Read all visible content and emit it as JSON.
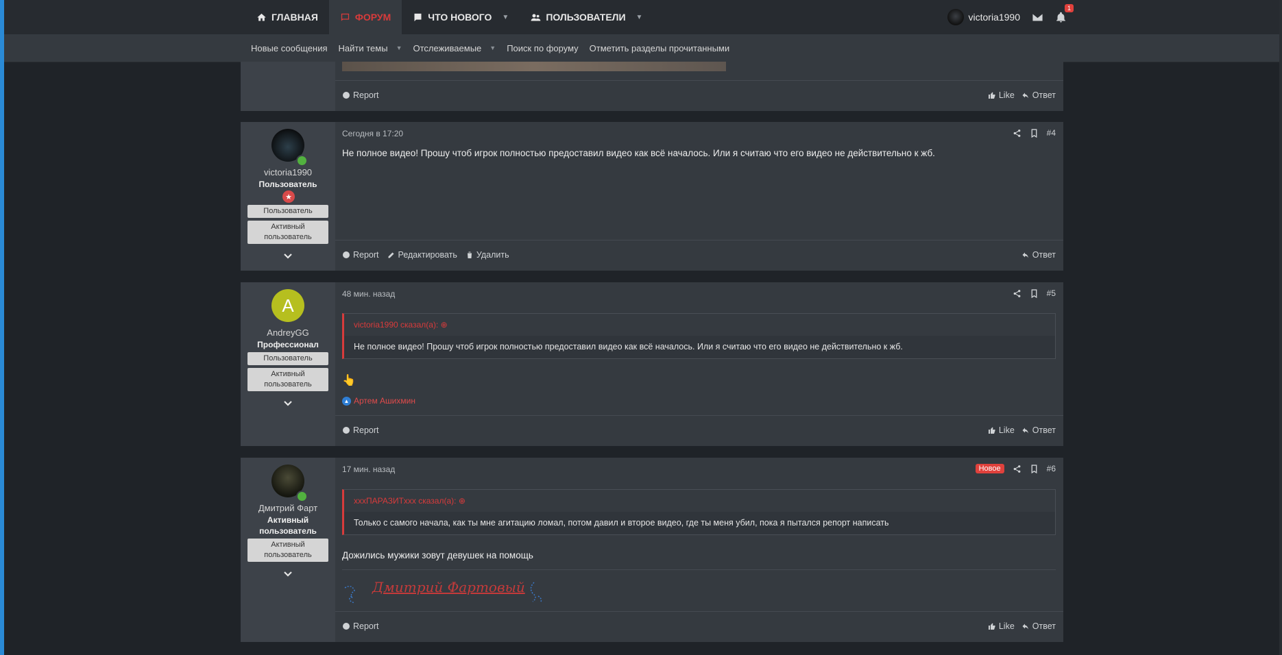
{
  "topnav": {
    "tabs": [
      {
        "label": "ГЛАВНАЯ",
        "icon": "home-icon"
      },
      {
        "label": "ФОРУМ",
        "icon": "forum-icon"
      },
      {
        "label": "ЧТО НОВОГО",
        "icon": "news-icon"
      },
      {
        "label": "ПОЛЬЗОВАТЕЛИ",
        "icon": "users-icon"
      }
    ],
    "username": "victoria1990",
    "alerts_count": "1"
  },
  "subnav": {
    "items": [
      {
        "label": "Новые сообщения"
      },
      {
        "label": "Найти темы"
      },
      {
        "label": "Отслеживаемые"
      },
      {
        "label": "Поиск по форуму"
      },
      {
        "label": "Отметить разделы прочитанными"
      }
    ]
  },
  "actions": {
    "report": "Report",
    "like": "Like",
    "reply": "Ответ",
    "edit": "Редактировать",
    "delete": "Удалить"
  },
  "posts": [
    {
      "user": "victoria1990",
      "title": "Пользователь",
      "badges": [
        "Пользователь",
        "Активный пользователь"
      ],
      "date": "Сегодня в 17:20",
      "num": "#4",
      "text": "Не полное видео! Прошу чтоб игрок полностью предоставил видео как всё началось. Или я считаю что его видео не действительно к жб."
    },
    {
      "user": "AndreyGG",
      "avatar_letter": "A",
      "title": "Профессионал",
      "badges": [
        "Пользователь",
        "Активный пользователь"
      ],
      "date": "48 мин. назад",
      "num": "#5",
      "quote_author": "victoria1990 сказал(а):",
      "quote_text": "Не полное видео! Прошу чтоб игрок полностью предоставил видео как всё началось. Или я считаю что его видео не действительно к жб.",
      "emoji": "👆",
      "liked_by": "Артем Ашихмин"
    },
    {
      "user": "Дмитрий Фарт",
      "title": "Активный пользователь",
      "badges": [
        "Активный пользователь"
      ],
      "date": "17 мин. назад",
      "num": "#6",
      "new_label": "Новое",
      "quote_author": "xxxПАРАЗИТxxx сказал(а):",
      "quote_text": "Только с самого начала, как ты мне агитацию ломал, потом давил и второе видео, где ты меня убил, пока я пытался репорт написать",
      "text": "Дожились мужики зовут девушек на помощь",
      "signature": "Дмитрий Фартовый"
    }
  ],
  "colors": {
    "accent": "#d83b3b",
    "background": "#1f2328",
    "panel": "#353a40",
    "online": "#52b13f"
  }
}
